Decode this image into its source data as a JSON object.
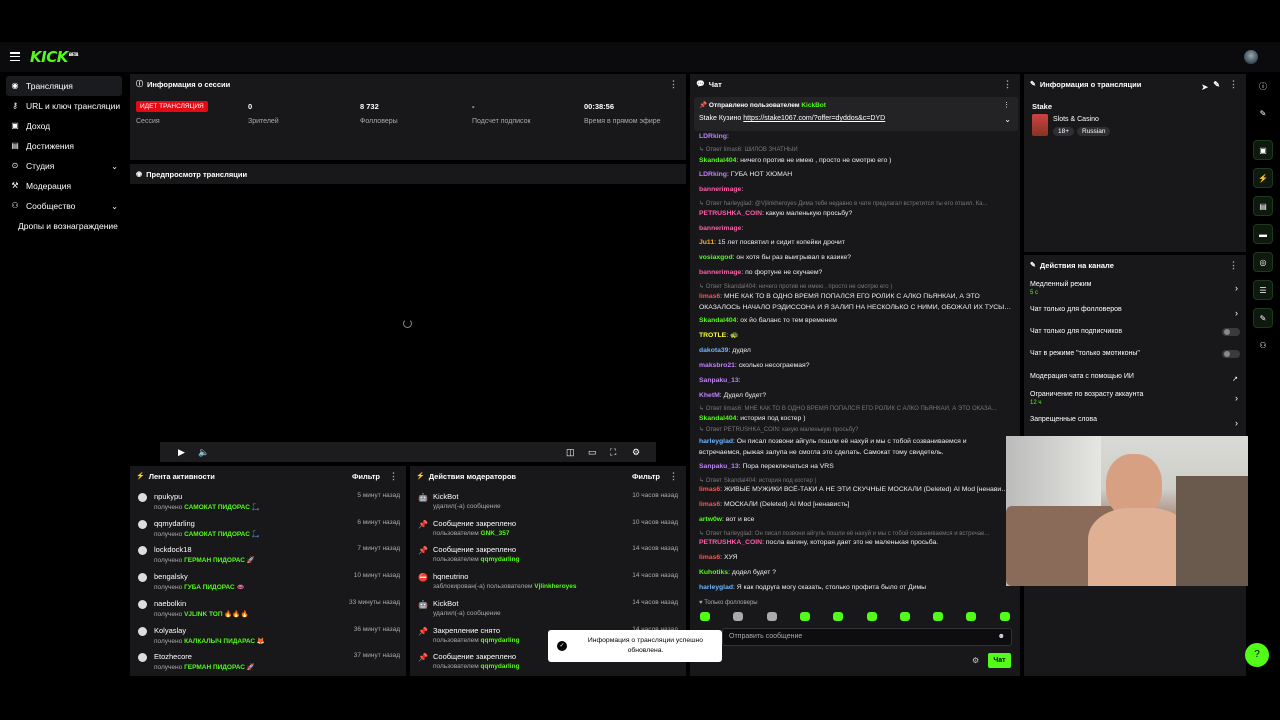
{
  "app": {
    "logo": "KICK",
    "logo_sup": "BETA"
  },
  "sidebar": {
    "items": [
      {
        "label": "Трансляция",
        "icon": "broadcast-icon"
      },
      {
        "label": "URL и ключ трансляции",
        "icon": "key-icon"
      },
      {
        "label": "Доход",
        "icon": "dollar-icon"
      },
      {
        "label": "Достижения",
        "icon": "trophy-icon"
      },
      {
        "label": "Студия",
        "icon": "studio-icon"
      },
      {
        "label": "Модерация",
        "icon": "hammer-icon"
      },
      {
        "label": "Сообщество",
        "icon": "users-icon"
      },
      {
        "label": "Дропы и вознаграждение",
        "icon": ""
      }
    ]
  },
  "session": {
    "title": "Информация о сессии",
    "badge": "ИДЕТ ТРАНСЛЯЦИЯ",
    "session_label": "Сессия",
    "stats": [
      {
        "value": "0",
        "label": "Зрителей"
      },
      {
        "value": "8 732",
        "label": "Фолловеры"
      },
      {
        "value": "-",
        "label": "Подсчет подписок"
      },
      {
        "value": "00:38:56",
        "label": "Время в прямом эфире"
      }
    ]
  },
  "preview": {
    "title": "Предпросмотр трансляции"
  },
  "activity": {
    "title": "Лента активности",
    "filter": "Фильтр",
    "items": [
      {
        "name": "npukypu",
        "pre": "получено",
        "reward": "САМОКАТ ПИДОРАС",
        "emoji": "🛴",
        "time": "5 минут назад"
      },
      {
        "name": "qqmydarling",
        "pre": "получено",
        "reward": "САМОКАТ ПИДОРАС",
        "emoji": "🛴",
        "time": "6 минут назад"
      },
      {
        "name": "lockdock18",
        "pre": "получено",
        "reward": "ГЕРМАН ПИДОРАС",
        "emoji": "🚀",
        "time": "7 минут назад"
      },
      {
        "name": "bengalsky",
        "pre": "получено",
        "reward": "ГУБА ПИДОРАС",
        "emoji": "👄",
        "time": "10 минут назад"
      },
      {
        "name": "naebolkin",
        "pre": "получено",
        "reward": "VJLINK ТОП",
        "emoji": "🔥🔥🔥",
        "time": "33 минуты назад"
      },
      {
        "name": "Kolyaslay",
        "pre": "получено",
        "reward": "КАЛКАЛЫЧ ПИДАРАС",
        "emoji": "🦊",
        "time": "36 минут назад"
      },
      {
        "name": "Etozhecore",
        "pre": "получено",
        "reward": "ГЕРМАН ПИДОРАС",
        "emoji": "🚀",
        "time": "37 минут назад"
      }
    ]
  },
  "modactions": {
    "title": "Действия модераторов",
    "filter": "Фильтр",
    "items": [
      {
        "icon": "🤖",
        "name": "KickBot",
        "sub": "удалил(-а) сообщение",
        "who": "",
        "time": "10 часов назад"
      },
      {
        "icon": "📌",
        "name": "Сообщение закреплено",
        "sub": "пользователем",
        "who": "GNK_357",
        "time": "10 часов назад"
      },
      {
        "icon": "📌",
        "name": "Сообщение закреплено",
        "sub": "пользователем",
        "who": "qqmydarling",
        "time": "14 часов назад"
      },
      {
        "icon": "⛔",
        "name": "hqneutrino",
        "sub": "заблокирован(-а) пользователем",
        "who": "Vjlinkheroyes",
        "time": "14 часов назад"
      },
      {
        "icon": "🤖",
        "name": "KickBot",
        "sub": "удалил(-а) сообщение",
        "who": "",
        "time": "14 часов назад"
      },
      {
        "icon": "📌",
        "name": "Закрепление снято",
        "sub": "пользователем",
        "who": "qqmydarling",
        "time": "14 часов назад"
      },
      {
        "icon": "📌",
        "name": "Сообщение закреплено",
        "sub": "пользователем",
        "who": "qqmydarling",
        "time": "14 часов назад"
      }
    ]
  },
  "chat": {
    "title": "Чат",
    "pinned_by": "Отправлено пользователем",
    "pinned_user": "KickBot",
    "pinned_text": "Stake Кузино",
    "pinned_link": "https://stake1067.com/?offer=dyddos&c=DYD",
    "lines": [
      {
        "kind": "msg",
        "user": "LDRking",
        "color": "#c080ff",
        "text": ""
      },
      {
        "kind": "reply",
        "text": "↳ Ответ limas6: ШИЛОВ ЗНАТНЫЙ"
      },
      {
        "kind": "msg",
        "user": "Skandal404",
        "color": "#53fc18",
        "text": "ничего против не имею , просто не смотрю его )"
      },
      {
        "kind": "msg",
        "user": "LDRking",
        "color": "#c080ff",
        "text": "ГУБА НОТ ХЮМАН"
      },
      {
        "kind": "msg",
        "user": "bannerimage",
        "color": "#ff5ca8",
        "text": ""
      },
      {
        "kind": "reply",
        "text": "↳ Ответ harleyglad: @Vjlinkheroyes Дима тебе недавно в чате предлагал встретится ты его отшил. Ка..."
      },
      {
        "kind": "msg",
        "user": "PETRUSHKA_COIN",
        "color": "#ff5ca8",
        "text": "какую маленькую просьбу?"
      },
      {
        "kind": "msg",
        "user": "bannerimage",
        "color": "#ff5ca8",
        "text": ""
      },
      {
        "kind": "msg",
        "user": "Ju11",
        "color": "#ffb020",
        "text": "15 лет посвятил и сидит копейки дрочит"
      },
      {
        "kind": "msg",
        "user": "vosiaxgod",
        "color": "#53fc18",
        "text": "он хотя бы раз выигрывал в казике?"
      },
      {
        "kind": "msg",
        "user": "bannerimage",
        "color": "#ff5ca8",
        "text": "по фортуне не скучаем?"
      },
      {
        "kind": "reply",
        "text": "↳ Ответ Skandal404: ничего против не имею , просто не смотрю его )"
      },
      {
        "kind": "msg",
        "user": "limas6",
        "color": "#ff5050",
        "text": "МНЕ КАК ТО В ОДНО ВРЕМЯ ПОПАЛСЯ ЕГО РОЛИК С АЛКО ПЬЯНКАИ, А ЭТО"
      },
      {
        "kind": "cont",
        "text": "ОКАЗАЛОСЬ НАЧАЛО РЭДИССОНА И Я ЗАЛИП НА НЕСКОЛЬКО С НИМИ, ОБОЖАЛ ИХ ТУСЫЧИ"
      },
      {
        "kind": "msg",
        "user": "Skandal404",
        "color": "#53fc18",
        "text": "ох йо баланс то тем временем"
      },
      {
        "kind": "msg",
        "user": "TROTLE",
        "color": "#ffff40",
        "text": "🐢"
      },
      {
        "kind": "msg",
        "user": "dakota39",
        "color": "#6cb4ff",
        "text": "дудел"
      },
      {
        "kind": "msg",
        "user": "maksbro21",
        "color": "#c080ff",
        "text": "сколько несограемая?"
      },
      {
        "kind": "msg",
        "user": "Sanpaku_13",
        "color": "#c080ff",
        "text": ""
      },
      {
        "kind": "msg",
        "user": "KhetM",
        "color": "#c080ff",
        "text": "Дудел будет?"
      },
      {
        "kind": "reply",
        "text": "↳ Ответ limas6: МНЕ КАК ТО В ОДНО ВРЕМЯ ПОПАЛСЯ ЕГО РОЛИК С АЛКО ПЬЯНКАИ, А ЭТО ОКАЗА..."
      },
      {
        "kind": "msg",
        "user": "Skandal404",
        "color": "#53fc18",
        "text": "история под костер )"
      },
      {
        "kind": "reply",
        "text": "↳ Ответ PETRUSHKA_COIN: какую маленькую просьбу?"
      },
      {
        "kind": "msg",
        "user": "harleyglad",
        "color": "#6cb4ff",
        "text": "Он писал позвони айгуль пошли её нахуй и мы с тобой созваниваемся и"
      },
      {
        "kind": "cont",
        "text": "встречаемся, рыжая залупа не смогла это сделать. Самокат тому свидетель."
      },
      {
        "kind": "msg",
        "user": "Sanpaku_13",
        "color": "#c080ff",
        "text": "Пора переключаться на VRS"
      },
      {
        "kind": "reply",
        "text": "↳ Ответ Skandal404: история под костер )"
      },
      {
        "kind": "msg",
        "user": "limas6",
        "color": "#ff5050",
        "text": "ЖИВЫЕ МУЖИКИ ВСЁ-ТАКИ А НЕ ЭТИ СКУЧНЫЕ МОСКАЛИ (Deleted) AI Mod [ненависть]"
      },
      {
        "kind": "msg",
        "user": "limas6",
        "color": "#ff5050",
        "text": "МОСКАЛИ (Deleted) AI Mod [ненависть]"
      },
      {
        "kind": "msg",
        "user": "artw0w",
        "color": "#53fc18",
        "text": "вот и все"
      },
      {
        "kind": "reply",
        "text": "↳ Ответ harleyglad: Он писал позвони айгуль пошли её нахуй и мы с тобой созваниваемся и встречае..."
      },
      {
        "kind": "msg",
        "user": "PETRUSHKA_COIN",
        "color": "#ff5ca8",
        "text": "посла вагину, которая дает это не маленькая просьба."
      },
      {
        "kind": "msg",
        "user": "limas6",
        "color": "#ff5050",
        "text": "ХУЯ"
      },
      {
        "kind": "msg",
        "user": "Kuhotiks",
        "color": "#53fc18",
        "text": "додел будет ?"
      },
      {
        "kind": "msg",
        "user": "harleyglad",
        "color": "#6cb4ff",
        "text": "Я как подруга могу сказать, столько профита было от Димы"
      }
    ],
    "followers_only": "Только фолловеры",
    "input_placeholder": "Отправить сообщение",
    "send_label": "Чат"
  },
  "stream_info": {
    "title": "Информация о трансляции",
    "stream_name": "Stake",
    "category": "Slots & Casino",
    "tags": [
      "18+",
      "Russian"
    ]
  },
  "channel_actions": {
    "title": "Действия на канале",
    "items": [
      {
        "label": "Медленный режим",
        "sub": "5 с",
        "control": "chevron"
      },
      {
        "label": "Чат только для фолловеров",
        "sub": "",
        "control": "chevron"
      },
      {
        "label": "Чат только для подписчиков",
        "sub": "",
        "control": "toggle"
      },
      {
        "label": "Чат в режиме \"только эмотиконы\"",
        "sub": "",
        "control": "toggle"
      },
      {
        "label": "Модерация чата с помощью ИИ",
        "sub": "",
        "control": "external"
      },
      {
        "label": "Ограничение по возрасту аккаунта",
        "sub": "12 ч",
        "control": "chevron"
      },
      {
        "label": "Запрещенные слова",
        "sub": "",
        "control": "chevron"
      }
    ]
  },
  "toast": {
    "message": "Информация о трансляции успешно обновлена."
  },
  "colors": {
    "accent": "#53fc18",
    "live": "#e50914",
    "panel": "#18181b"
  }
}
